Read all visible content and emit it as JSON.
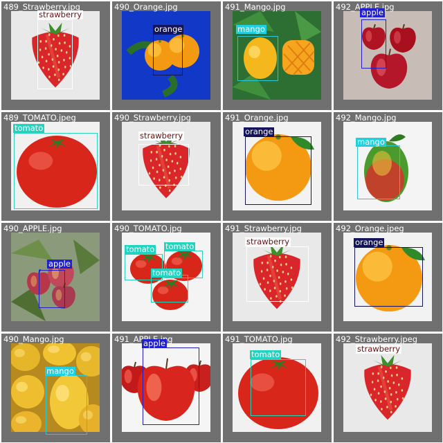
{
  "classes": {
    "strawberry": {
      "box": "#ffffff",
      "tag_bg": "#ffffff",
      "tag_fg": "#6b0f0f"
    },
    "orange": {
      "box": "#14145a",
      "tag_bg": "#14145a",
      "tag_fg": "#ffffff"
    },
    "mango": {
      "box": "#27c8d8",
      "tag_bg": "#1fd0e0",
      "tag_fg": "#ffffff"
    },
    "apple": {
      "box": "#2020c0",
      "tag_bg": "#2020d0",
      "tag_fg": "#ffffff"
    },
    "tomato": {
      "box": "#2ad4b8",
      "tag_bg": "#22d4c0",
      "tag_fg": "#ffffff"
    }
  },
  "tiles": [
    {
      "filename": "489_Strawberry.jpg",
      "subject": "strawberry",
      "detections": [
        {
          "label": "strawberry"
        }
      ]
    },
    {
      "filename": "490_Orange.jpg",
      "subject": "orange-pair",
      "detections": [
        {
          "label": "orange"
        }
      ]
    },
    {
      "filename": "491_Mango.jpg",
      "subject": "mango",
      "detections": [
        {
          "label": "mango"
        }
      ]
    },
    {
      "filename": "492_APPLE.jpg",
      "subject": "apple-group",
      "detections": [
        {
          "label": "apple"
        }
      ]
    },
    {
      "filename": "489_TOMATO.jpeg",
      "subject": "tomato",
      "detections": [
        {
          "label": "tomato"
        }
      ]
    },
    {
      "filename": "490_Strawberry.jpg",
      "subject": "strawberry",
      "detections": [
        {
          "label": "strawberry"
        }
      ]
    },
    {
      "filename": "491_Orange.jpg",
      "subject": "orange",
      "detections": [
        {
          "label": "orange"
        }
      ]
    },
    {
      "filename": "492_Mango.jpg",
      "subject": "mango-red",
      "detections": [
        {
          "label": "mango"
        }
      ]
    },
    {
      "filename": "490_APPLE.jpg",
      "subject": "apple-tree",
      "detections": [
        {
          "label": "apple"
        }
      ]
    },
    {
      "filename": "490_TOMATO.jpg",
      "subject": "tomato-group",
      "detections": [
        {
          "label": "tomato"
        },
        {
          "label": "tomato"
        },
        {
          "label": "tomato"
        }
      ]
    },
    {
      "filename": "491_Strawberry.jpg",
      "subject": "strawberry",
      "detections": [
        {
          "label": "strawberry"
        }
      ]
    },
    {
      "filename": "492_Orange.jpeg",
      "subject": "orange",
      "detections": [
        {
          "label": "orange"
        }
      ]
    },
    {
      "filename": "490_Mango.jpg",
      "subject": "mango-pile",
      "detections": [
        {
          "label": "mango"
        }
      ]
    },
    {
      "filename": "491_APPLE.jpg",
      "subject": "apple",
      "detections": [
        {
          "label": "apple"
        }
      ]
    },
    {
      "filename": "491_TOMATO.jpg",
      "subject": "tomato",
      "detections": [
        {
          "label": "tomato"
        }
      ]
    },
    {
      "filename": "492_Strawberry.jpeg",
      "subject": "strawberry",
      "detections": [
        {
          "label": "strawberry"
        }
      ]
    }
  ]
}
